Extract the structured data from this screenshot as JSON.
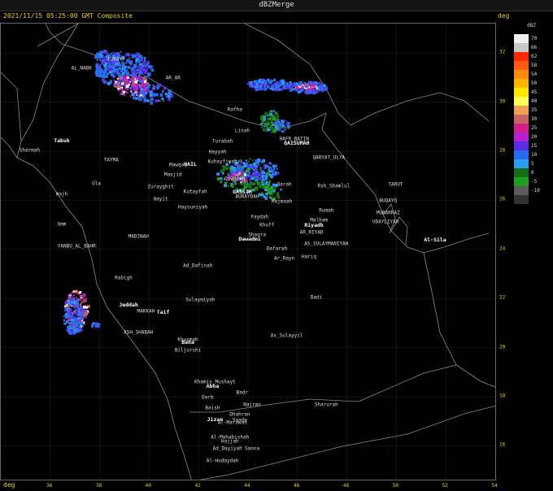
{
  "window_title": "dBZMerge",
  "timestamp": "2021/11/15 05:25:00 GMT Composite",
  "axis_unit": "deg",
  "legend": {
    "unit": "dBZ",
    "entries": [
      {
        "value": "70",
        "color": "#f0f0f0"
      },
      {
        "value": "66",
        "color": "#c8c8c8"
      },
      {
        "value": "62",
        "color": "#ff2a00"
      },
      {
        "value": "58",
        "color": "#ff5a10"
      },
      {
        "value": "54",
        "color": "#ff8c10"
      },
      {
        "value": "50",
        "color": "#ffb400"
      },
      {
        "value": "45",
        "color": "#ffe600"
      },
      {
        "value": "40",
        "color": "#ffff55"
      },
      {
        "value": "35",
        "color": "#f0a050"
      },
      {
        "value": "30",
        "color": "#c86464"
      },
      {
        "value": "25",
        "color": "#d41e8c"
      },
      {
        "value": "20",
        "color": "#b420d2"
      },
      {
        "value": "15",
        "color": "#5a2ce6"
      },
      {
        "value": "10",
        "color": "#2a6cf0"
      },
      {
        "value": "5",
        "color": "#2a9cf8"
      },
      {
        "value": "0",
        "color": "#146e14"
      },
      {
        "value": "-5",
        "color": "#1ea01e"
      },
      {
        "value": "-10",
        "color": "#5a5a5a"
      },
      {
        "value": "",
        "color": "#323232"
      }
    ]
  },
  "lat_ticks": [
    "32",
    "30",
    "28",
    "26",
    "24",
    "22",
    "20",
    "18",
    "16"
  ],
  "lon_ticks": [
    "36",
    "38",
    "40",
    "42",
    "44",
    "46",
    "48",
    "50",
    "52",
    "54"
  ],
  "places": [
    {
      "name": "TURAYF",
      "lon": 38.7,
      "lat": 31.7,
      "bold": false
    },
    {
      "name": "AR_AR",
      "lon": 41.0,
      "lat": 30.95,
      "bold": false
    },
    {
      "name": "AL_NABK",
      "lon": 37.3,
      "lat": 31.35,
      "bold": false
    },
    {
      "name": "Rafha",
      "lon": 43.5,
      "lat": 29.65,
      "bold": false
    },
    {
      "name": "Linah",
      "lon": 43.8,
      "lat": 28.8,
      "bold": false
    },
    {
      "name": "Turabah",
      "lon": 43.0,
      "lat": 28.35,
      "bold": false
    },
    {
      "name": "Hayyah",
      "lon": 42.8,
      "lat": 27.95,
      "bold": false
    },
    {
      "name": "Kuhayfiyah",
      "lon": 43.0,
      "lat": 27.55,
      "bold": false
    },
    {
      "name": "QAISUMAH",
      "lon": 46.0,
      "lat": 28.3,
      "bold": true
    },
    {
      "name": "HAFR_BATIN",
      "lon": 45.9,
      "lat": 28.45,
      "bold": false
    },
    {
      "name": "QARYAT_ULYA",
      "lon": 47.3,
      "lat": 27.7,
      "bold": false
    },
    {
      "name": "Tabuk",
      "lon": 36.5,
      "lat": 28.4,
      "bold": true
    },
    {
      "name": "Sharmah",
      "lon": 35.2,
      "lat": 28.0,
      "bold": false
    },
    {
      "name": "TAYMA",
      "lon": 38.5,
      "lat": 27.6,
      "bold": false
    },
    {
      "name": "Mawqaq",
      "lon": 41.2,
      "lat": 27.4,
      "bold": false
    },
    {
      "name": "HAIL",
      "lon": 41.7,
      "lat": 27.45,
      "bold": true
    },
    {
      "name": "Masjid",
      "lon": 41.0,
      "lat": 27.0,
      "bold": false
    },
    {
      "name": "Quwarah",
      "lon": 43.5,
      "lat": 26.85,
      "bold": false
    },
    {
      "name": "Ula",
      "lon": 37.9,
      "lat": 26.65,
      "bold": false
    },
    {
      "name": "Zurayghit",
      "lon": 40.5,
      "lat": 26.5,
      "bold": false
    },
    {
      "name": "Kutayfah",
      "lon": 41.9,
      "lat": 26.3,
      "bold": false
    },
    {
      "name": "GASSIM",
      "lon": 43.8,
      "lat": 26.3,
      "bold": true
    },
    {
      "name": "BURAYDAH",
      "lon": 44.0,
      "lat": 26.1,
      "bold": false
    },
    {
      "name": "Qarah",
      "lon": 45.5,
      "lat": 26.6,
      "bold": false
    },
    {
      "name": "Rsh_Shamlul",
      "lon": 47.5,
      "lat": 26.55,
      "bold": false
    },
    {
      "name": "TARUT",
      "lon": 50.0,
      "lat": 26.6,
      "bold": false
    },
    {
      "name": "Wajh",
      "lon": 36.5,
      "lat": 26.2,
      "bold": false
    },
    {
      "name": "Hayit",
      "lon": 40.5,
      "lat": 26.0,
      "bold": false
    },
    {
      "name": "Majmaah",
      "lon": 45.4,
      "lat": 25.9,
      "bold": false
    },
    {
      "name": "BUQAYQ",
      "lon": 49.7,
      "lat": 25.95,
      "bold": false
    },
    {
      "name": "Haysuniyah",
      "lon": 41.8,
      "lat": 25.7,
      "bold": false
    },
    {
      "name": "Rumah",
      "lon": 47.2,
      "lat": 25.55,
      "bold": false
    },
    {
      "name": "MUBARRAZ",
      "lon": 49.7,
      "lat": 25.45,
      "bold": false
    },
    {
      "name": "Faydah",
      "lon": 44.5,
      "lat": 25.3,
      "bold": false
    },
    {
      "name": "Malham",
      "lon": 46.9,
      "lat": 25.15,
      "bold": false
    },
    {
      "name": "UDAYLIYAH",
      "lon": 49.6,
      "lat": 25.1,
      "bold": false
    },
    {
      "name": "Umm",
      "lon": 36.5,
      "lat": 25.0,
      "bold": false
    },
    {
      "name": "Khuff",
      "lon": 44.8,
      "lat": 24.95,
      "bold": false
    },
    {
      "name": "Riyadh",
      "lon": 46.7,
      "lat": 24.95,
      "bold": true
    },
    {
      "name": "AR_RIYAD",
      "lon": 46.6,
      "lat": 24.65,
      "bold": false
    },
    {
      "name": "Shaqra",
      "lon": 44.4,
      "lat": 24.55,
      "bold": false
    },
    {
      "name": "Dawadmi",
      "lon": 44.1,
      "lat": 24.4,
      "bold": true
    },
    {
      "name": "MADINAH",
      "lon": 39.6,
      "lat": 24.5,
      "bold": false
    },
    {
      "name": "AS_SULAYMANIYAH",
      "lon": 47.2,
      "lat": 24.2,
      "bold": false
    },
    {
      "name": "Al-Sila",
      "lon": 51.6,
      "lat": 24.35,
      "bold": true
    },
    {
      "name": "YANBU_AL_BAHR",
      "lon": 37.1,
      "lat": 24.1,
      "bold": false
    },
    {
      "name": "Dafarah",
      "lon": 45.2,
      "lat": 24.0,
      "bold": false
    },
    {
      "name": "Ar_Rayn",
      "lon": 45.5,
      "lat": 23.6,
      "bold": false
    },
    {
      "name": "Hariq",
      "lon": 46.5,
      "lat": 23.65,
      "bold": false
    },
    {
      "name": "Ad_Dafinah",
      "lon": 42.0,
      "lat": 23.3,
      "bold": false
    },
    {
      "name": "Rabigh",
      "lon": 39.0,
      "lat": 22.8,
      "bold": false
    },
    {
      "name": "Badi",
      "lon": 46.8,
      "lat": 22.0,
      "bold": false
    },
    {
      "name": "Sulaymiyah",
      "lon": 42.1,
      "lat": 21.9,
      "bold": false
    },
    {
      "name": "Jeddah",
      "lon": 39.2,
      "lat": 21.7,
      "bold": true
    },
    {
      "name": "MAKKAH",
      "lon": 39.9,
      "lat": 21.45,
      "bold": false
    },
    {
      "name": "Taif",
      "lon": 40.6,
      "lat": 21.4,
      "bold": true
    },
    {
      "name": "ASH_SHABAH",
      "lon": 39.6,
      "lat": 20.6,
      "bold": false
    },
    {
      "name": "Khurmah",
      "lon": 41.6,
      "lat": 20.3,
      "bold": false
    },
    {
      "name": "Baha",
      "lon": 41.6,
      "lat": 20.2,
      "bold": true
    },
    {
      "name": "As_Sulayyil",
      "lon": 45.6,
      "lat": 20.45,
      "bold": false
    },
    {
      "name": "Biljurshi",
      "lon": 41.6,
      "lat": 19.85,
      "bold": false
    },
    {
      "name": "Khamis_Mushayt",
      "lon": 42.7,
      "lat": 18.55,
      "bold": false
    },
    {
      "name": "Abha",
      "lon": 42.6,
      "lat": 18.4,
      "bold": true
    },
    {
      "name": "Badr",
      "lon": 43.8,
      "lat": 18.15,
      "bold": false
    },
    {
      "name": "Darb",
      "lon": 42.4,
      "lat": 17.95,
      "bold": false
    },
    {
      "name": "Najran",
      "lon": 44.2,
      "lat": 17.65,
      "bold": false
    },
    {
      "name": "Sharurah",
      "lon": 47.2,
      "lat": 17.65,
      "bold": false
    },
    {
      "name": "Baish",
      "lon": 42.6,
      "lat": 17.5,
      "bold": false
    },
    {
      "name": "Dhahran",
      "lon": 43.7,
      "lat": 17.25,
      "bold": false
    },
    {
      "name": "Jizan",
      "lon": 42.7,
      "lat": 17.05,
      "bold": true
    },
    {
      "name": "Saada",
      "lon": 43.7,
      "lat": 17.0,
      "bold": false
    },
    {
      "name": "Hajjah",
      "lon": 43.3,
      "lat": 16.15,
      "bold": false
    },
    {
      "name": "Al-Mahabishah",
      "lon": 43.3,
      "lat": 16.3,
      "bold": false
    },
    {
      "name": "Ad_Dayiyah",
      "lon": 43.2,
      "lat": 15.85,
      "bold": false
    },
    {
      "name": "Sanna",
      "lon": 44.2,
      "lat": 15.85,
      "bold": false
    },
    {
      "name": "Al-Hudaydah",
      "lon": 43.0,
      "lat": 15.35,
      "bold": false
    },
    {
      "name": "Al-Marawah",
      "lon": 43.4,
      "lat": 16.9,
      "bold": false
    }
  ]
}
